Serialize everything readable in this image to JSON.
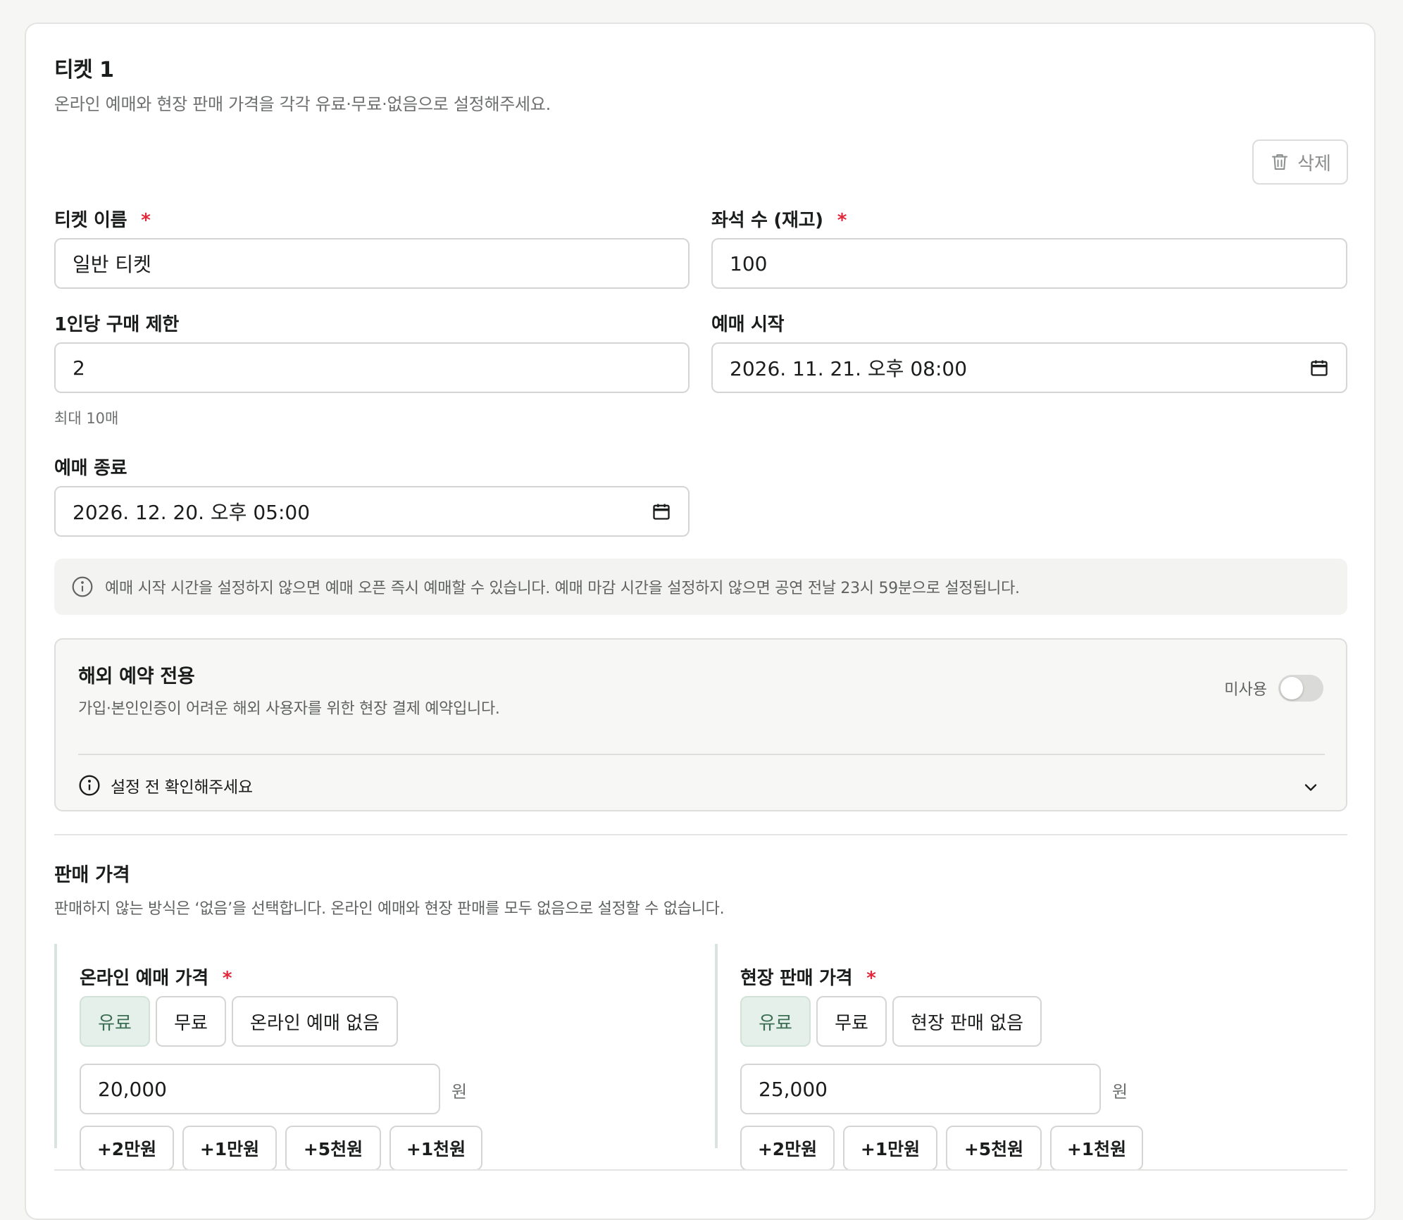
{
  "ticket": {
    "title": "티켓 1",
    "subtitle": "온라인 예매와 현장 판매 가격을 각각 유료·무료·없음으로 설정해주세요.",
    "delete_label": "삭제",
    "required_mark": "*"
  },
  "fields": {
    "name": {
      "label": "티켓 이름",
      "value": "일반 티켓"
    },
    "seats": {
      "label": "좌석 수 (재고)",
      "value": "100"
    },
    "limit": {
      "label": "1인당 구매 제한",
      "value": "2",
      "hint": "최대 10매"
    },
    "sale_start": {
      "label": "예매 시작",
      "value": "2026. 11. 21. 오후 08:00"
    },
    "sale_end": {
      "label": "예매 종료",
      "value": "2026. 12. 20. 오후 05:00"
    }
  },
  "info_notice": "예매 시작 시간을 설정하지 않으면 예매 오픈 즉시 예매할 수 있습니다. 예매 마감 시간을 설정하지 않으면 공연 전날 23시 59분으로 설정됩니다.",
  "overseas": {
    "title": "해외 예약 전용",
    "description": "가입·본인인증이 어려운 해외 사용자를 위한 현장 결제 예약입니다.",
    "toggle_label": "미사용",
    "enabled": false,
    "check_label": "설정 전 확인해주세요"
  },
  "pricing": {
    "title": "판매 가격",
    "description": "판매하지 않는 방식은 ‘없음’을 선택합니다. 온라인 예매와 현장 판매를 모두 없음으로 설정할 수 없습니다.",
    "currency": "원",
    "online": {
      "label": "온라인 예매 가격",
      "options": [
        "유료",
        "무료",
        "온라인 예매 없음"
      ],
      "selected": "유료",
      "value": "20,000",
      "quick": [
        "+2만원",
        "+1만원",
        "+5천원",
        "+1천원"
      ]
    },
    "onsite": {
      "label": "현장 판매 가격",
      "options": [
        "유료",
        "무료",
        "현장 판매 없음"
      ],
      "selected": "유료",
      "value": "25,000",
      "quick": [
        "+2만원",
        "+1만원",
        "+5천원",
        "+1천원"
      ]
    }
  },
  "colors": {
    "accent_bg": "#e5f0ea",
    "accent_text": "#3b6e53",
    "required": "#e0283a"
  },
  "icons": {
    "delete": "trash-icon",
    "calendar": "calendar-icon",
    "info": "info-icon",
    "chevron": "chevron-down-icon"
  }
}
